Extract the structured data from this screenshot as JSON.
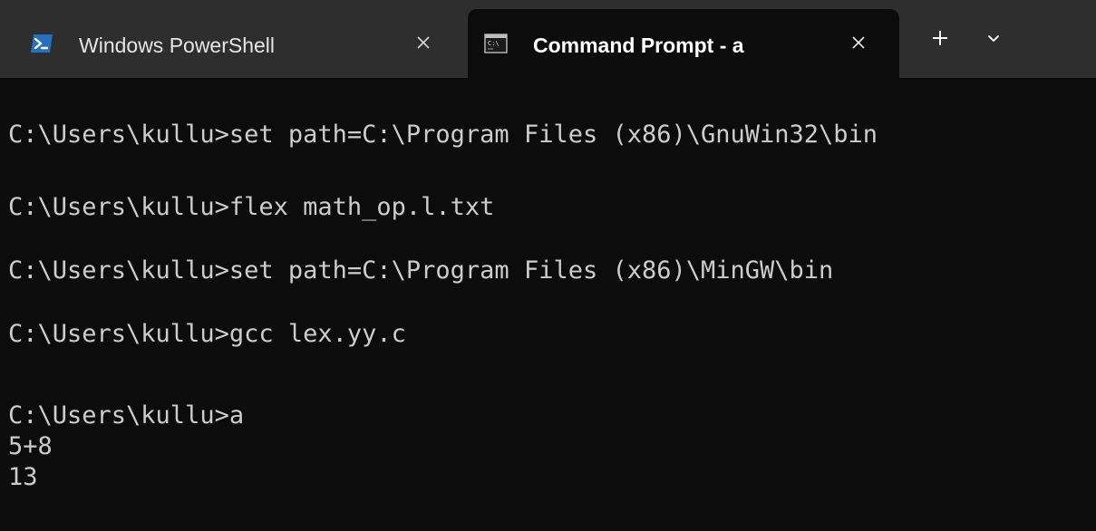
{
  "window": {
    "tabs": [
      {
        "title": "Windows PowerShell",
        "icon": "powershell-icon",
        "active": false
      },
      {
        "title": "Command Prompt - a",
        "icon": "command-prompt-icon",
        "active": true
      }
    ],
    "new_tab_icon": "plus-icon",
    "dropdown_icon": "chevron-down-icon",
    "close_icon": "close-icon"
  },
  "colors": {
    "tabbar_background": "#2e2e2e",
    "active_tab_background": "#0c0c0c",
    "terminal_background": "#0c0c0c",
    "terminal_text": "#cccccc",
    "powershell_icon": "#2671be"
  },
  "terminal": {
    "lines": [
      "C:\\Users\\kullu>set path=C:\\Program Files (x86)\\GnuWin32\\bin",
      "C:\\Users\\kullu>flex math_op.l.txt",
      "C:\\Users\\kullu>set path=C:\\Program Files (x86)\\MinGW\\bin",
      "C:\\Users\\kullu>gcc lex.yy.c",
      "C:\\Users\\kullu>a",
      "5+8",
      "13"
    ]
  }
}
